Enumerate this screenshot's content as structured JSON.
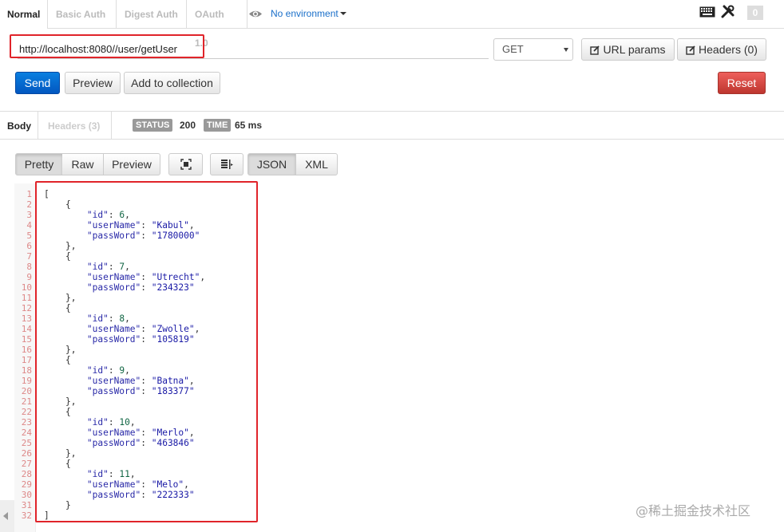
{
  "auth_tabs": [
    "Normal",
    "Basic Auth",
    "Digest Auth",
    "OAuth 1.0"
  ],
  "environment": "No environment",
  "badge_count": "0",
  "url": "http://localhost:8080//user/getUser",
  "method": "GET",
  "buttons": {
    "url_params": "URL params",
    "headers": "Headers (0)",
    "send": "Send",
    "preview": "Preview",
    "add_collection": "Add to collection",
    "reset": "Reset"
  },
  "response": {
    "tab_body": "Body",
    "tab_headers": "Headers (3)",
    "status_label": "STATUS",
    "status_value": "200",
    "time_label": "TIME",
    "time_value": "65 ms"
  },
  "view_buttons": [
    "Pretty",
    "Raw",
    "Preview",
    "JSON",
    "XML"
  ],
  "users": [
    {
      "id": 6,
      "userName": "Kabul",
      "passWord": "1780000"
    },
    {
      "id": 7,
      "userName": "Utrecht",
      "passWord": "234323"
    },
    {
      "id": 8,
      "userName": "Zwolle",
      "passWord": "105819"
    },
    {
      "id": 9,
      "userName": "Batna",
      "passWord": "183377"
    },
    {
      "id": 10,
      "userName": "Merlo",
      "passWord": "463846"
    },
    {
      "id": 11,
      "userName": "Melo",
      "passWord": "222333"
    }
  ],
  "watermark": "@稀土掘金技术社区",
  "colors": {
    "send": "#0a6fd8",
    "reset": "#d9534f",
    "highlight": "#e0242a"
  }
}
